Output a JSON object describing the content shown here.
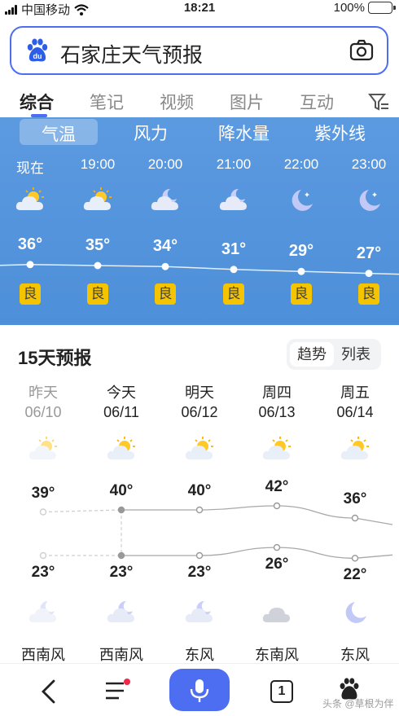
{
  "status_bar": {
    "carrier": "中国移动",
    "time": "18:21",
    "battery": "100%"
  },
  "search": {
    "query": "石家庄天气预报",
    "logo_text": "du"
  },
  "tabs": [
    "综合",
    "笔记",
    "视频",
    "图片",
    "互动"
  ],
  "hourly": {
    "metric_tabs": [
      "气温",
      "风力",
      "降水量",
      "紫外线"
    ],
    "hours": [
      {
        "time": "现在",
        "icon": "sun-cloud-icon",
        "temp": "36°",
        "aqi": "良"
      },
      {
        "time": "19:00",
        "icon": "sun-cloud-icon",
        "temp": "35°",
        "aqi": "良"
      },
      {
        "time": "20:00",
        "icon": "moon-cloud-icon",
        "temp": "34°",
        "aqi": "良"
      },
      {
        "time": "21:00",
        "icon": "moon-cloud-icon",
        "temp": "31°",
        "aqi": "良"
      },
      {
        "time": "22:00",
        "icon": "moon-icon",
        "temp": "29°",
        "aqi": "良"
      },
      {
        "time": "23:00",
        "icon": "moon-icon",
        "temp": "27°",
        "aqi": "良"
      }
    ]
  },
  "forecast": {
    "title": "15天预报",
    "toggle": [
      "趋势",
      "列表"
    ],
    "days": [
      {
        "name": "昨天",
        "date": "06/10",
        "high": "39°",
        "low": "23°",
        "day_icon": "sun-cloud-icon",
        "night_icon": "moon-cloud-icon",
        "wind": "西南风",
        "past": true
      },
      {
        "name": "今天",
        "date": "06/11",
        "high": "40°",
        "low": "23°",
        "day_icon": "sun-cloud-icon",
        "night_icon": "moon-cloud-icon",
        "wind": "西南风",
        "past": false
      },
      {
        "name": "明天",
        "date": "06/12",
        "high": "40°",
        "low": "23°",
        "day_icon": "sun-cloud-icon",
        "night_icon": "moon-cloud-icon",
        "wind": "东风",
        "past": false
      },
      {
        "name": "周四",
        "date": "06/13",
        "high": "42°",
        "low": "26°",
        "day_icon": "sun-cloud-icon",
        "night_icon": "cloud-icon",
        "wind": "东南风",
        "past": false
      },
      {
        "name": "周五",
        "date": "06/14",
        "high": "36°",
        "low": "22°",
        "day_icon": "sun-cloud-icon",
        "night_icon": "moon-icon",
        "wind": "东风",
        "past": false
      }
    ]
  },
  "bottom_nav": {
    "tabs_count": "1",
    "watermark": "头条 @草根为伴"
  },
  "colors": {
    "accent": "#4e6ef2",
    "hourly_bg": "#5c9ae0",
    "aqi_good": "#f5c400"
  }
}
